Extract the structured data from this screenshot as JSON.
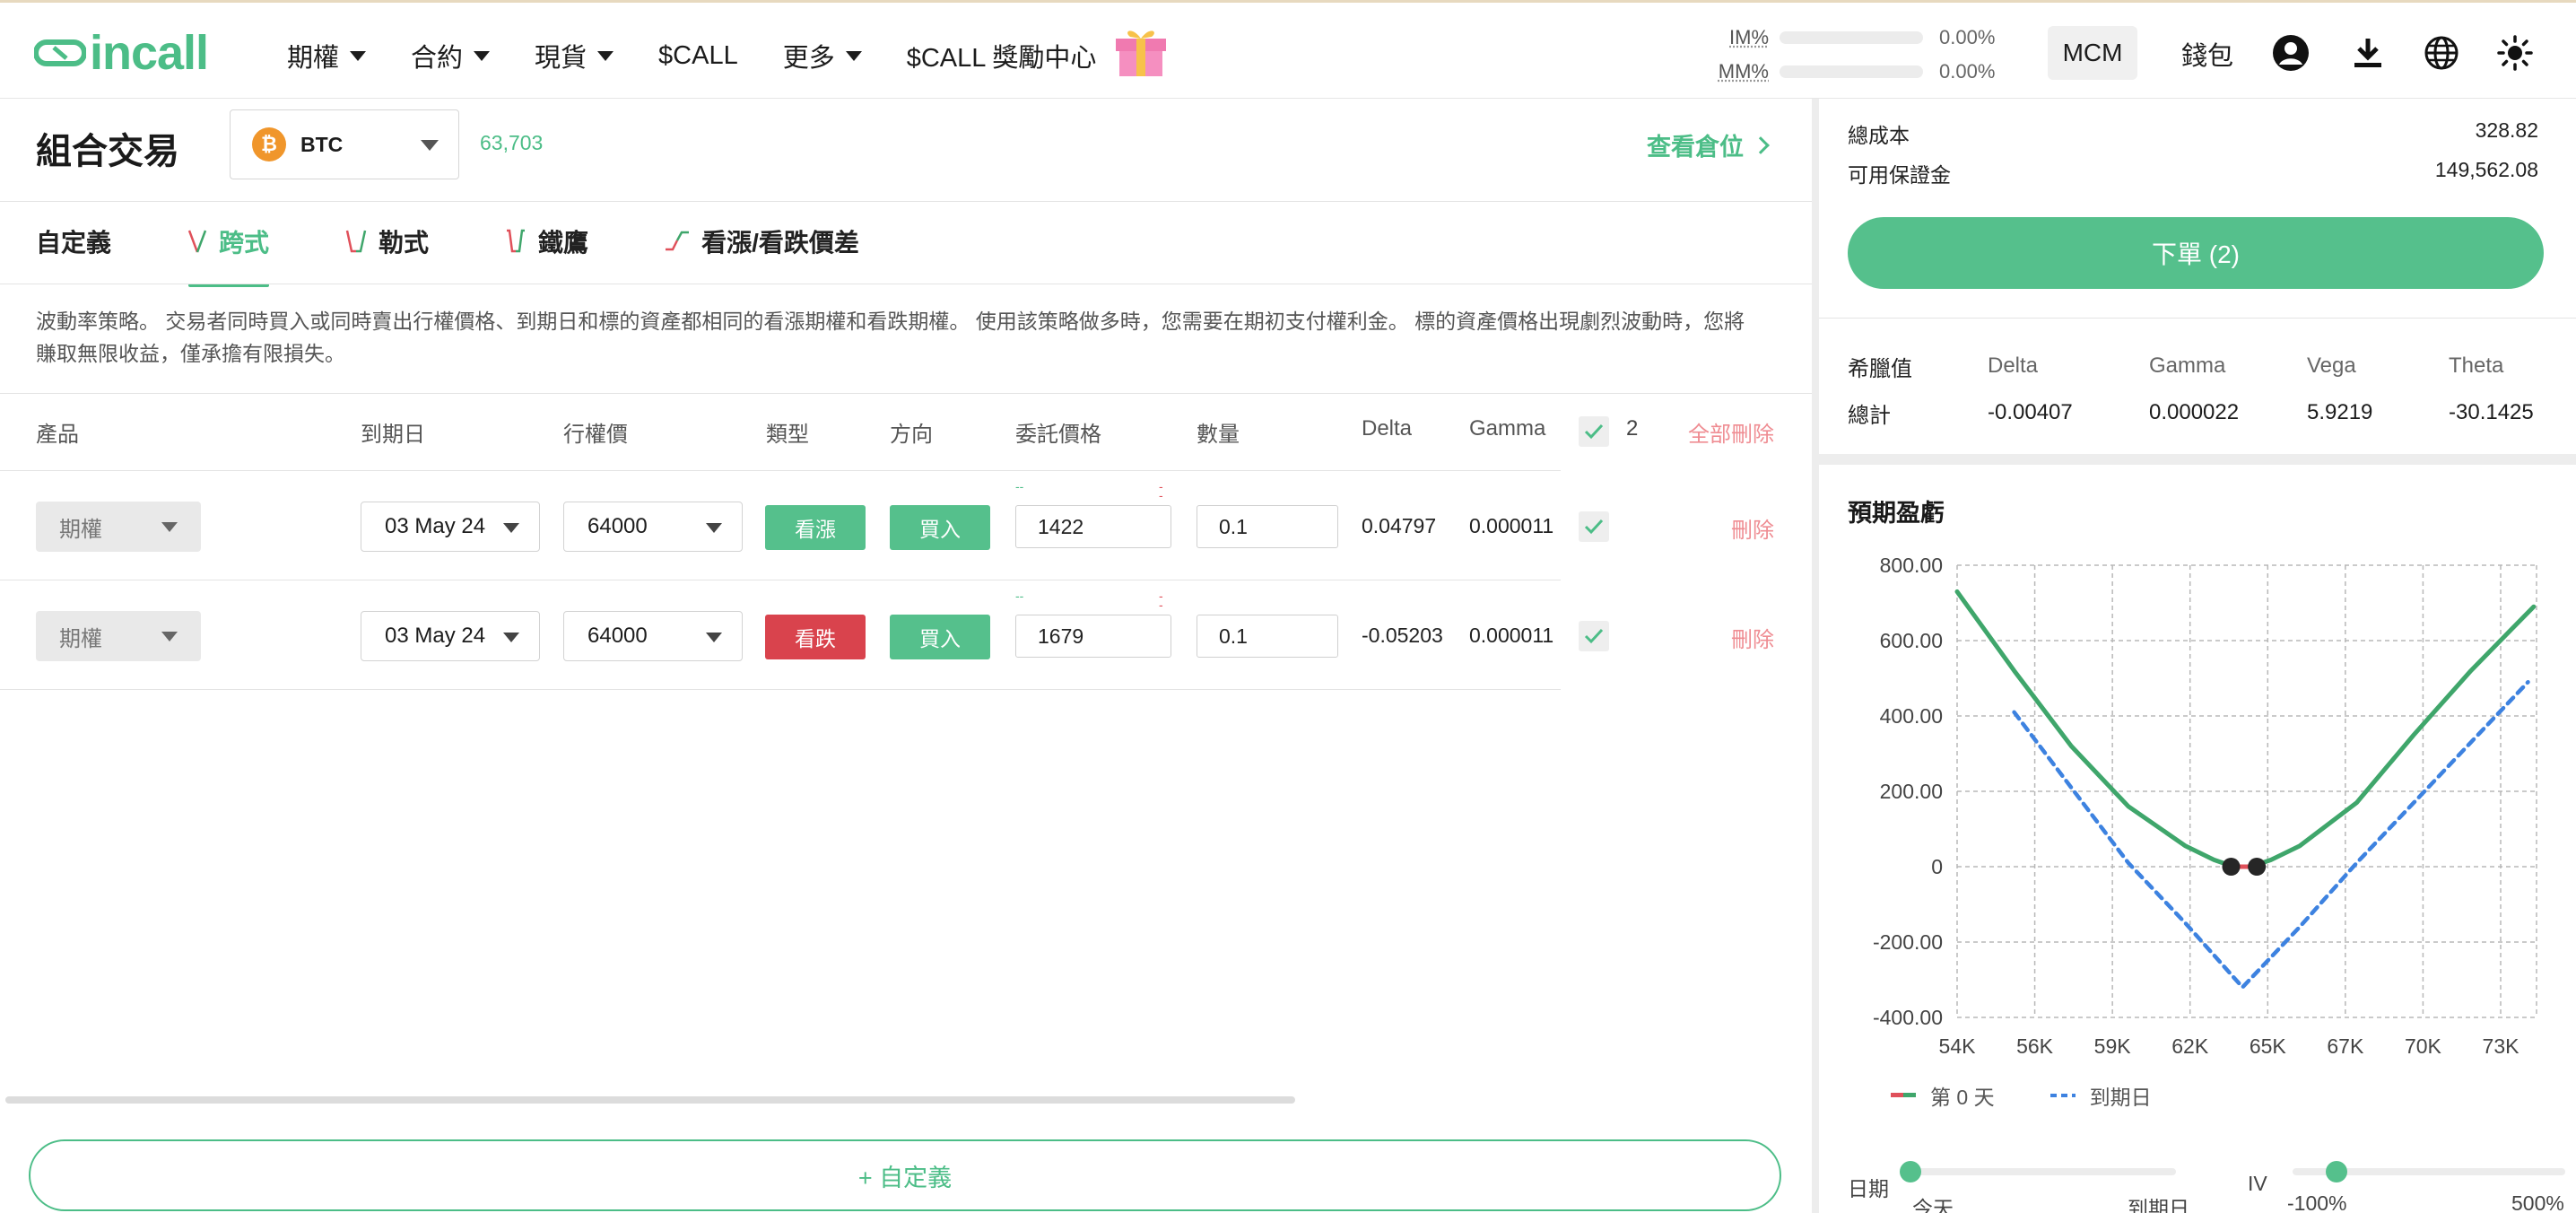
{
  "nav": {
    "logo": "incall",
    "items": [
      {
        "label": "期權",
        "dropdown": true
      },
      {
        "label": "合約",
        "dropdown": true
      },
      {
        "label": "現貨",
        "dropdown": true
      },
      {
        "label": "$CALL",
        "dropdown": false
      },
      {
        "label": "更多",
        "dropdown": true
      },
      {
        "label": "$CALL 獎勵中心",
        "dropdown": false
      }
    ],
    "im_label": "IM%",
    "im_value": "0.00%",
    "mm_label": "MM%",
    "mm_value": "0.00%",
    "mcm": "MCM",
    "wallet": "錢包",
    "icons": [
      "user-icon",
      "download-icon",
      "globe-icon",
      "sun-icon"
    ]
  },
  "header": {
    "title": "組合交易",
    "asset": "BTC",
    "asset_symbol": "₿",
    "price": "63,703",
    "view_positions": "查看倉位"
  },
  "tabs": [
    {
      "label": "自定義",
      "active": false
    },
    {
      "label": "跨式",
      "active": true
    },
    {
      "label": "勒式",
      "active": false
    },
    {
      "label": "鐵鷹",
      "active": false
    },
    {
      "label": "看漲/看跌價差",
      "active": false
    }
  ],
  "description": "波動率策略。 交易者同時買入或同時賣出行權價格、到期日和標的資產都相同的看漲期權和看跌期權。 使用該策略做多時，您需要在期初支付權利金。 標的資產價格出現劇烈波動時，您將賺取無限收益，僅承擔有限損失。",
  "table": {
    "headers": {
      "product": "產品",
      "expiry": "到期日",
      "strike": "行權價",
      "type": "類型",
      "direction": "方向",
      "price": "委託價格",
      "qty": "數量",
      "delta": "Delta",
      "gamma": "Gamma",
      "count": "2",
      "delete_all": "全部刪除"
    },
    "rows": [
      {
        "product": "期權",
        "expiry": "03 May 24",
        "strike": "64000",
        "type": "看漲",
        "type_color": "#55c08c",
        "direction": "買入",
        "bid_tick": "--",
        "ask_tick": "--",
        "price": "1422",
        "qty": "0.1",
        "delta": "0.04797",
        "gamma": "0.000011",
        "delete": "刪除"
      },
      {
        "product": "期權",
        "expiry": "03 May 24",
        "strike": "64000",
        "type": "看跌",
        "type_color": "#d9434d",
        "direction": "買入",
        "bid_tick": "--",
        "ask_tick": "--",
        "price": "1679",
        "qty": "0.1",
        "delta": "-0.05203",
        "gamma": "0.000011",
        "delete": "刪除"
      }
    ],
    "add_custom": "+ 自定義"
  },
  "summary": {
    "total_cost_label": "總成本",
    "total_cost": "328.82",
    "available_margin_label": "可用保證金",
    "available_margin": "149,562.08",
    "order_button": "下單 (2)"
  },
  "greeks": {
    "header": [
      "希臘值",
      "Delta",
      "Gamma",
      "Vega",
      "Theta"
    ],
    "total": [
      "總計",
      "-0.00407",
      "0.000022",
      "5.9219",
      "-30.1425"
    ]
  },
  "pnl": {
    "title": "預期盈虧",
    "legend": [
      {
        "label": "第 0 天",
        "colors": [
          "#e0505a",
          "#3fa66b"
        ]
      },
      {
        "label": "到期日",
        "colors": [
          "#3d82e0"
        ]
      }
    ],
    "sliders": {
      "date_label": "日期",
      "date_min": "今天",
      "date_max": "到期日",
      "date_value": 0,
      "iv_label": "IV",
      "iv_min": "-100%",
      "iv_max": "500%",
      "iv_value": 0.16
    }
  },
  "chart_data": {
    "type": "line",
    "x_ticks": [
      "54K",
      "56K",
      "59K",
      "62K",
      "65K",
      "67K",
      "70K",
      "73K"
    ],
    "y_ticks": [
      "800.00",
      "600.00",
      "400.00",
      "200.00",
      "0",
      "-200.00",
      "-400.00"
    ],
    "xlim": [
      54000,
      74300
    ],
    "ylim": [
      -400,
      800
    ],
    "grid": true,
    "series": [
      {
        "name": "第 0 天",
        "style": "solid",
        "color": "#3fa66b",
        "x": [
          54000,
          56000,
          58000,
          60000,
          62000,
          63000,
          63500,
          63800,
          64200,
          64500,
          65000,
          66000,
          68000,
          70000,
          72000,
          74200
        ],
        "y": [
          730,
          520,
          320,
          160,
          55,
          18,
          5,
          0,
          0,
          5,
          18,
          55,
          170,
          350,
          520,
          690
        ]
      },
      {
        "name": "到期日",
        "style": "dashed",
        "color": "#3d82e0",
        "x": [
          56000,
          60000,
          62000,
          64000,
          66000,
          68000,
          70000,
          72000,
          74000
        ],
        "y": [
          410,
          10,
          -150,
          -320,
          -160,
          10,
          170,
          330,
          490
        ]
      }
    ],
    "markers": [
      {
        "x": 63600,
        "y": 0
      },
      {
        "x": 64500,
        "y": 0
      }
    ]
  }
}
